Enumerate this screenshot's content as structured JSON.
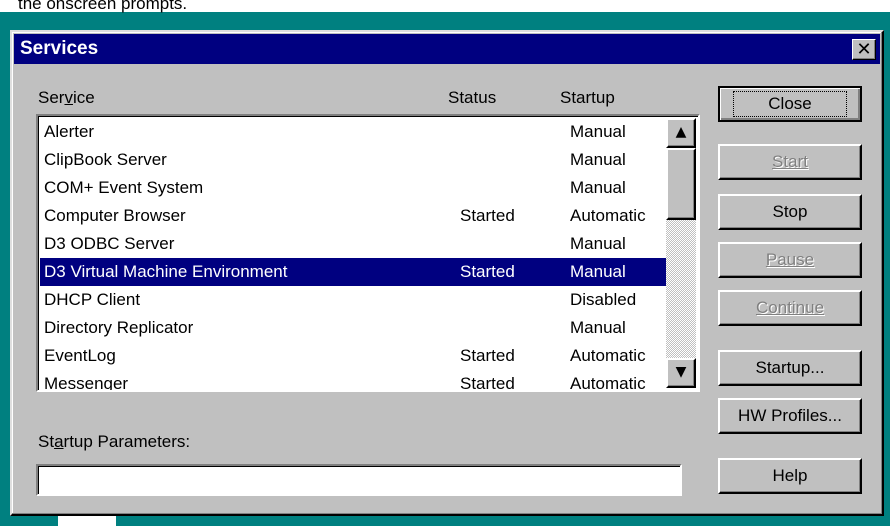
{
  "background": {
    "caption": "the onscreen prompts."
  },
  "dialog": {
    "title": "Services",
    "close_glyph": "✕",
    "columns": {
      "service": "Service",
      "status": "Status",
      "startup": "Startup"
    },
    "services": [
      {
        "name": "Alerter",
        "status": "",
        "startup": "Manual"
      },
      {
        "name": "ClipBook Server",
        "status": "",
        "startup": "Manual"
      },
      {
        "name": "COM+ Event System",
        "status": "",
        "startup": "Manual"
      },
      {
        "name": "Computer Browser",
        "status": "Started",
        "startup": "Automatic"
      },
      {
        "name": "D3 ODBC Server",
        "status": "",
        "startup": "Manual"
      },
      {
        "name": "D3 Virtual Machine Environment",
        "status": "Started",
        "startup": "Manual",
        "selected": true
      },
      {
        "name": "DHCP Client",
        "status": "",
        "startup": "Disabled"
      },
      {
        "name": "Directory Replicator",
        "status": "",
        "startup": "Manual"
      },
      {
        "name": "EventLog",
        "status": "Started",
        "startup": "Automatic"
      },
      {
        "name": "Messenger",
        "status": "Started",
        "startup": "Automatic"
      }
    ],
    "startup_parameters_label": "Startup Parameters:",
    "startup_parameters_value": "",
    "scroll_up_glyph": "▲",
    "scroll_down_glyph": "▼",
    "buttons": {
      "close": "Close",
      "start": "Start",
      "stop": "Stop",
      "pause": "Pause",
      "continue": "Continue",
      "startup": "Startup...",
      "hw_profiles": "HW Profiles...",
      "help": "Help"
    },
    "colors": {
      "title_bar": "#000080",
      "selection": "#000080",
      "desktop": "#008080",
      "face": "#c0c0c0"
    }
  }
}
